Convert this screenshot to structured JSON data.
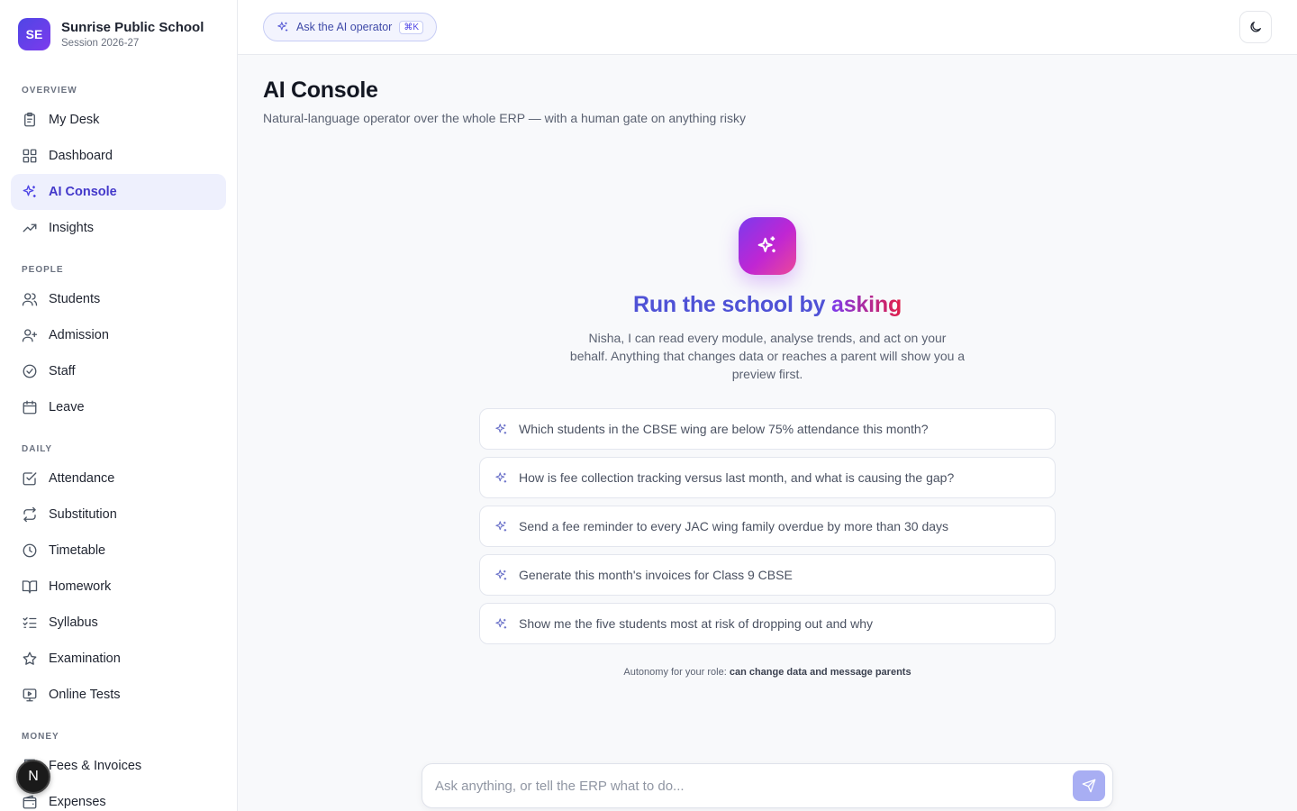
{
  "brand": {
    "initials": "SE",
    "name": "Sunrise Public School",
    "session": "Session 2026-27"
  },
  "sidebar": {
    "sections": [
      {
        "title": "OVERVIEW",
        "items": [
          {
            "label": "My Desk",
            "icon": "clipboard-icon"
          },
          {
            "label": "Dashboard",
            "icon": "grid-icon"
          },
          {
            "label": "AI Console",
            "icon": "sparkles-icon",
            "active": true
          },
          {
            "label": "Insights",
            "icon": "trending-up-icon"
          }
        ]
      },
      {
        "title": "PEOPLE",
        "items": [
          {
            "label": "Students",
            "icon": "users-icon"
          },
          {
            "label": "Admission",
            "icon": "user-plus-icon"
          },
          {
            "label": "Staff",
            "icon": "check-circle-icon"
          },
          {
            "label": "Leave",
            "icon": "calendar-icon"
          }
        ]
      },
      {
        "title": "DAILY",
        "items": [
          {
            "label": "Attendance",
            "icon": "check-square-icon"
          },
          {
            "label": "Substitution",
            "icon": "repeat-icon"
          },
          {
            "label": "Timetable",
            "icon": "clock-icon"
          },
          {
            "label": "Homework",
            "icon": "book-open-icon"
          },
          {
            "label": "Syllabus",
            "icon": "list-checks-icon"
          },
          {
            "label": "Examination",
            "icon": "star-icon"
          },
          {
            "label": "Online Tests",
            "icon": "monitor-play-icon"
          }
        ]
      },
      {
        "title": "MONEY",
        "items": [
          {
            "label": "Fees & Invoices",
            "icon": "receipt-icon"
          },
          {
            "label": "Expenses",
            "icon": "wallet-icon"
          }
        ]
      }
    ]
  },
  "user": {
    "initial": "N"
  },
  "topbar": {
    "ask_label": "Ask the AI operator",
    "shortcut": "⌘K"
  },
  "page": {
    "title": "AI Console",
    "subtitle": "Natural-language operator over the whole ERP — with a human gate on anything risky"
  },
  "hero": {
    "title_part1": "Run the school by ",
    "title_part2": "asking",
    "description": "Nisha, I can read every module, analyse trends, and act on your behalf. Anything that changes data or reaches a parent will show you a preview first."
  },
  "suggestions": [
    "Which students in the CBSE wing are below 75% attendance this month?",
    "How is fee collection tracking versus last month, and what is causing the gap?",
    "Send a fee reminder to every JAC wing family overdue by more than 30 days",
    "Generate this month's invoices for Class 9 CBSE",
    "Show me the five students most at risk of dropping out and why"
  ],
  "autonomy": {
    "label": "Autonomy for your role:",
    "value": "can change data and message parents"
  },
  "composer": {
    "placeholder": "Ask anything, or tell the ERP what to do..."
  },
  "colors": {
    "accent": "#4f46e5",
    "active_bg": "#eef0fd",
    "send": "#a8aef3"
  }
}
